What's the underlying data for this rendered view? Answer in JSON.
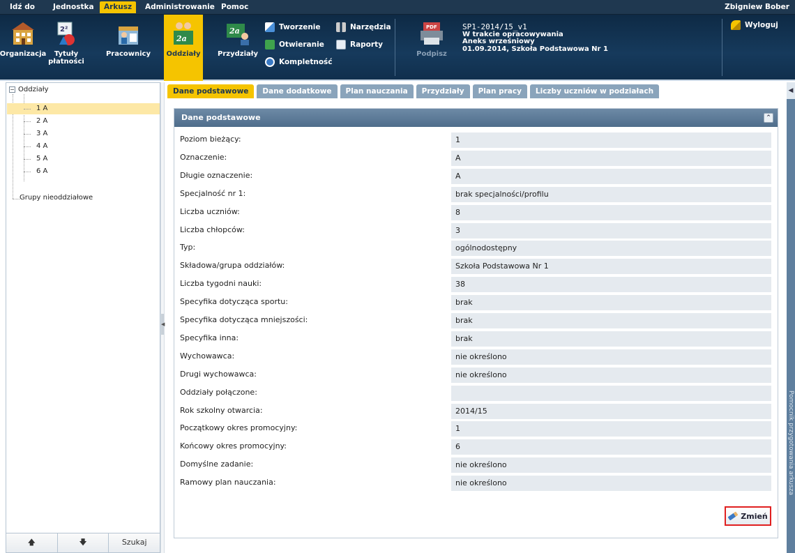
{
  "menubar": {
    "items": [
      "Idź do",
      "Jednostka",
      "Arkusz",
      "Administrowanie",
      "Pomoc"
    ],
    "active": "Arkusz",
    "user": "Zbigniew Bober"
  },
  "toolbar": {
    "buttons": {
      "organizacja": "Organizacja",
      "tytuly_line1": "Tytuły",
      "tytuly_line2": "płatności",
      "pracownicy": "Pracownicy",
      "oddzialy": "Oddziały",
      "przydzialy": "Przydziały"
    },
    "small": {
      "tworzenie": "Tworzenie",
      "otwieranie": "Otwieranie",
      "kompletnosc": "Kompletność",
      "narzedzia": "Narzędzia",
      "raporty": "Raporty"
    },
    "sign_label": "Podpisz",
    "pdf_label": "PDF",
    "logout": "Wyloguj"
  },
  "document": {
    "name": "SP1-2014/15_v1",
    "status": "W trakcie opracowywania",
    "type": "Aneks wrześniowy",
    "date_school": "01.09.2014, Szkoła Podstawowa Nr 1"
  },
  "tree": {
    "root": "Oddziały",
    "items": [
      "1 A",
      "2 A",
      "3 A",
      "4 A",
      "5 A",
      "6 A"
    ],
    "selected": "1 A",
    "group": "Grupy nieoddziałowe",
    "footer": {
      "up": "🡅",
      "down": "🡇",
      "search": "Szukaj"
    }
  },
  "tabs": [
    "Dane podstawowe",
    "Dane dodatkowe",
    "Plan nauczania",
    "Przydziały",
    "Plan pracy",
    "Liczby uczniów w podziałach"
  ],
  "panel": {
    "title": "Dane podstawowe",
    "rows": [
      {
        "label": "Poziom bieżący:",
        "value": "1"
      },
      {
        "label": "Oznaczenie:",
        "value": "A"
      },
      {
        "label": "Długie oznaczenie:",
        "value": "A"
      },
      {
        "label": "Specjalność nr 1:",
        "value": "brak specjalności/profilu"
      },
      {
        "label": "Liczba uczniów:",
        "value": "8"
      },
      {
        "label": "Liczba chłopców:",
        "value": "3"
      },
      {
        "label": "Typ:",
        "value": "ogólnodostępny"
      },
      {
        "label": "Składowa/grupa oddziałów:",
        "value": "Szkoła Podstawowa Nr 1"
      },
      {
        "label": "Liczba tygodni nauki:",
        "value": "38"
      },
      {
        "label": "Specyfika dotycząca sportu:",
        "value": "brak"
      },
      {
        "label": "Specyfika dotycząca mniejszości:",
        "value": "brak"
      },
      {
        "label": "Specyfika inna:",
        "value": "brak"
      },
      {
        "label": "Wychowawca:",
        "value": "nie określono"
      },
      {
        "label": "Drugi wychowawca:",
        "value": "nie określono"
      },
      {
        "label": "Oddziały połączone:",
        "value": ""
      },
      {
        "label": "Rok szkolny otwarcia:",
        "value": "2014/15"
      },
      {
        "label": "Początkowy okres promocyjny:",
        "value": "1"
      },
      {
        "label": "Końcowy okres promocyjny:",
        "value": "6"
      },
      {
        "label": "Domyślne zadanie:",
        "value": "nie określono"
      },
      {
        "label": "Ramowy plan nauczania:",
        "value": "nie określono"
      }
    ],
    "change_label": "Zmień"
  },
  "right_strip": {
    "text": "Pomocnik przygotowania arkusza"
  },
  "colors": {
    "accent": "#f5c400",
    "navy": "#1f3850",
    "tab": "#8aa4bb",
    "value_bg": "#e5eaef",
    "highlight": "#e02020"
  }
}
